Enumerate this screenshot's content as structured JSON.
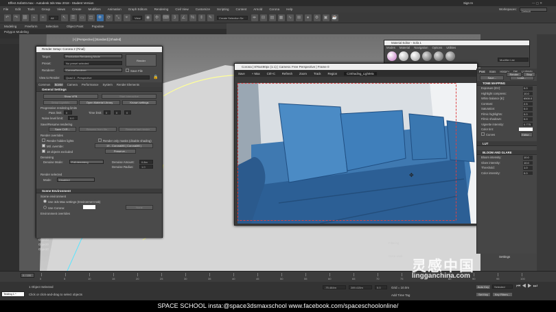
{
  "app": {
    "title": "Effect.Sofa03.max - Autodesk 3ds Max 2018 - Student Version",
    "signin": "Sign In",
    "workspaces_label": "Workspaces:",
    "workspaces_value": "Default"
  },
  "menu": [
    "File",
    "Edit",
    "Tools",
    "Group",
    "Views",
    "Create",
    "Modifiers",
    "Animation",
    "Graph Editors",
    "Rendering",
    "Civil View",
    "Customize",
    "Scripting",
    "Content",
    "Arnold",
    "Corona",
    "Help"
  ],
  "toolbar": {
    "selection_set": "Create Selection Se"
  },
  "ribbon": {
    "tabs": [
      "Modeling",
      "Freeform",
      "Selection",
      "Object Paint",
      "Populate"
    ],
    "sub": "Polygon Modeling"
  },
  "scene": {
    "tabs": [
      "Select",
      "Display"
    ],
    "viewport_label": "[+] [Perspective] [Standard] [Shaded]",
    "objects": [
      "Object0",
      "Object0",
      "Object0"
    ]
  },
  "render_setup": {
    "title": "Render Setup: Corona 2 (Final)",
    "target_label": "Target:",
    "target_value": "Production Rendering Mode",
    "preset_label": "Preset:",
    "preset_value": "No preset selected",
    "renderer_label": "Renderer:",
    "renderer_value": "CoronaRenderer",
    "view_label": "View to Render:",
    "view_value": "Quad 4 - Perspective",
    "render_button": "Render",
    "save_file": "Save File",
    "tabs": [
      "Common",
      "Scene",
      "Camera",
      "Performance",
      "System",
      "Render Elements"
    ],
    "general_settings": "General Settings",
    "show_vfb": "Show VFB",
    "start_interactive": "Start Interactive",
    "setup_lightmix": "Setup LightMix",
    "open_material_library": "Open Material Library",
    "known_settings": "Known settings",
    "prog_limits": "Progressive rendering limits",
    "pass_limit_label": "Pass limit:",
    "pass_limit_value": "0",
    "time_limit_label": "Time limit:",
    "time_limit_values": [
      "0",
      "0",
      "0"
    ],
    "noise_label": "Noise level limit:",
    "noise_value": "0.0",
    "save_resume": "Save/Resume rendering",
    "save_cxr": "Save CXR...",
    "resume_from_file": "Resume from file...",
    "resume_last": "Resume last render",
    "render_overrides": "Render overrides",
    "render_hidden": "Render hidden lights",
    "render_only_masks": "Render only masks (disable shading)",
    "mtl_override": "Mtl. override:",
    "mtl_override_value": "19 - CoronaMtl ( CoronaMtl )",
    "objects_excluded": "18 objects excluded",
    "preserve": "Preserve...",
    "denoising": "Denoising",
    "denoise_mode_label": "Denoise Mode:",
    "denoise_mode_value": "Full denoising",
    "denoise_amount_label": "Denoise Amount:",
    "denoise_amount_value": "0.8m",
    "denoise_radius_label": "Denoise Radius:",
    "denoise_radius_value": "1.0",
    "render_selected": "Render selected",
    "mode_label": "Mode:",
    "mode_value": "Disabled",
    "scene_environment": "Scene Environment",
    "scene_env_sub": "Scene environment",
    "use_3ds": "Use 3ds Max settings (Environment tab)",
    "use_corona": "Use Corona:",
    "env_overrides": "Environment overrides"
  },
  "fb": {
    "title": "Corona | 876x490px (1:1) | Camera: Free Perspective | Frame 0",
    "tools": [
      "Save",
      "+ Max",
      "Ctrl+C",
      "Refresh",
      "Zoom",
      "Track",
      "Region"
    ],
    "lightmix": "C3Shading_LightMix",
    "tabs": [
      "Post",
      "Stats",
      "History",
      "DR",
      "LightMix"
    ],
    "save_btn": "Save...",
    "load_btn": "Load...",
    "tone_mapping": "TONE MAPPING",
    "tm": [
      [
        "Exposure (EV):",
        "0.0"
      ],
      [
        "Highlight compress:",
        "10.0"
      ],
      [
        "White balance [K]:",
        "6500.0"
      ],
      [
        "Contrast:",
        "2.5"
      ],
      [
        "Saturation:",
        "0.0"
      ],
      [
        "Filmic highlights:",
        "0.0"
      ],
      [
        "Filmic shadows:",
        "0.0"
      ],
      [
        "Vignette intensity:",
        "0.775"
      ]
    ],
    "color_tint": "Color tint:",
    "curves": "Curves",
    "editor": "Editor...",
    "lut": "LUT",
    "bloom_glare": "BLOOM AND GLARE",
    "bg": [
      [
        "Bloom intensity:",
        "10.0"
      ],
      [
        "Glare intensity:",
        "10.0"
      ],
      [
        "Threshold:",
        "1.0"
      ],
      [
        "Color intensity:",
        "0.0"
      ]
    ],
    "render_btn": "Render",
    "stop_btn": "Stop",
    "filtering": "Filtering",
    "done_work": "Done work"
  },
  "mat_editor": {
    "title": "Material Editor - Sofa 1",
    "menu": [
      "Modes",
      "Material",
      "Navigation",
      "Options",
      "Utilities"
    ]
  },
  "modifier_list": "Modifier List",
  "timeline": {
    "frame": "0 / 100",
    "ticks": [
      "0",
      "5",
      "10",
      "15",
      "20",
      "25",
      "30",
      "35",
      "40",
      "45",
      "50",
      "55",
      "60",
      "65",
      "70",
      "75",
      "80",
      "85",
      "90",
      "95",
      "100"
    ]
  },
  "status": {
    "selected": "1 Object Selected",
    "hint": "Click or click-and-drag to select objects",
    "maxscript": "Testing 1 *",
    "x": "-75.464m",
    "y": "289.415m",
    "z": "0.0",
    "grid": "Grid = 10.0m",
    "add_time_tag": "Add Time Tag",
    "auto_key": "Auto Key",
    "selected_btn": "Selected",
    "set_key": "Set Key",
    "key_filters": "Key Filters..."
  },
  "panel": {
    "settings": "Settings",
    "output": "Output"
  },
  "footer": "SPACE SCHOOL   insta:@space3dsmaxschool   www.facebook.com/spaceschoolonline/",
  "watermark": {
    "line1": "灵感中国",
    "line2": "lingganchina.com"
  }
}
